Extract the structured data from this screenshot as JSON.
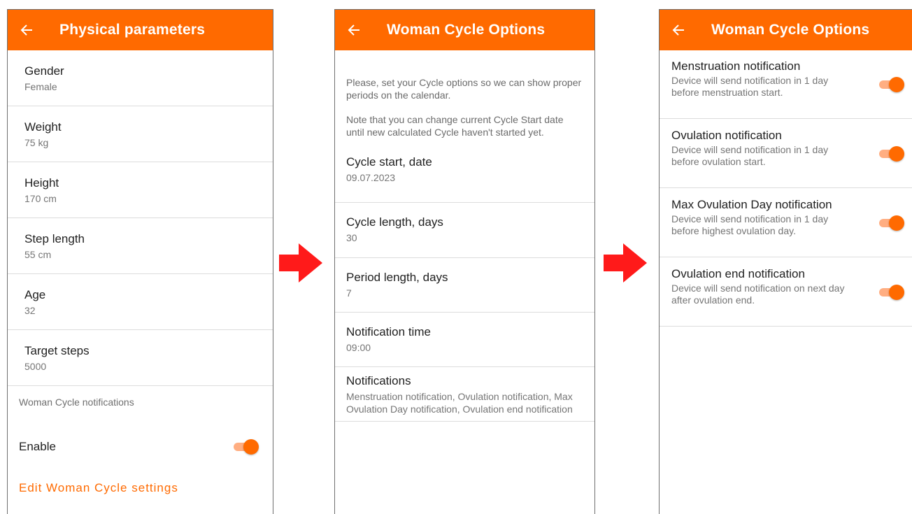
{
  "colors": {
    "accent": "#ff6a00",
    "arrow": "#ff1a1a"
  },
  "screen1": {
    "title": "Physical parameters",
    "items": [
      {
        "label": "Gender",
        "value": "Female"
      },
      {
        "label": "Weight",
        "value": "75 kg"
      },
      {
        "label": "Height",
        "value": "170 cm"
      },
      {
        "label": "Step length",
        "value": "55 cm"
      },
      {
        "label": "Age",
        "value": "32"
      },
      {
        "label": "Target steps",
        "value": "5000"
      }
    ],
    "section_header": "Woman Cycle notifications",
    "enable_label": "Enable",
    "enable_on": true,
    "edit_link": "Edit Woman Cycle settings"
  },
  "screen2": {
    "title": "Woman Cycle Options",
    "intro1": "Please, set your Cycle options so we can show proper periods on the calendar.",
    "intro2": "Note that you can change current Cycle Start date until new calculated Cycle haven't started yet.",
    "items": [
      {
        "label": "Cycle start, date",
        "value": "09.07.2023"
      },
      {
        "label": "Cycle length, days",
        "value": "30"
      },
      {
        "label": "Period length, days",
        "value": "7"
      },
      {
        "label": "Notification time",
        "value": "09:00"
      },
      {
        "label": "Notifications",
        "value": "Menstruation notification, Ovulation notification, Max Ovulation Day notification, Ovulation end notification"
      }
    ]
  },
  "screen3": {
    "title": "Woman Cycle Options",
    "items": [
      {
        "label": "Menstruation notification",
        "desc": "Device will send notification in 1 day before menstruation start.",
        "on": true
      },
      {
        "label": "Ovulation notification",
        "desc": "Device will send notification in 1 day before ovulation start.",
        "on": true
      },
      {
        "label": "Max Ovulation Day notification",
        "desc": "Device will send notification in 1 day before highest ovulation day.",
        "on": true
      },
      {
        "label": "Ovulation end notification",
        "desc": "Device will send notification on next day after ovulation end.",
        "on": true
      }
    ]
  },
  "icons": {
    "back": "arrow-left-icon",
    "toggle": "toggle-switch",
    "flow": "right-arrow-icon"
  }
}
